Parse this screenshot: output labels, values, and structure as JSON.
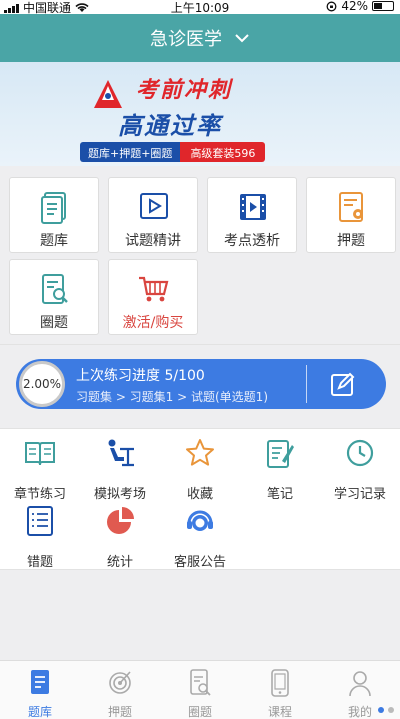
{
  "status_bar": {
    "carrier": "中国联通",
    "time": "上午10:09",
    "battery": "42%"
  },
  "header": {
    "title": "急诊医学"
  },
  "banner": {
    "headline": "考前冲刺",
    "subheadline": "高通过率",
    "bundle": "题库+押题+圈题",
    "package": "高级套装596"
  },
  "grid_items": [
    {
      "label": "题库",
      "icon": "question-bank-icon"
    },
    {
      "label": "试题精讲",
      "icon": "video-play-icon"
    },
    {
      "label": "考点透析",
      "icon": "film-icon"
    },
    {
      "label": "押题",
      "icon": "certificate-icon"
    },
    {
      "label": "圈题",
      "icon": "document-search-icon"
    },
    {
      "label": "激活/购买",
      "icon": "shopping-cart-icon"
    }
  ],
  "progress": {
    "percent": "2.00%",
    "title": "上次练习进度 5/100",
    "path": "习题集 > 习题集1 > 试题(单选题1)"
  },
  "features": [
    {
      "label": "章节练习",
      "icon": "open-book-icon"
    },
    {
      "label": "模拟考场",
      "icon": "exam-desk-icon"
    },
    {
      "label": "收藏",
      "icon": "star-icon"
    },
    {
      "label": "笔记",
      "icon": "notebook-icon"
    },
    {
      "label": "学习记录",
      "icon": "history-clock-icon"
    },
    {
      "label": "错题",
      "icon": "wrong-list-icon"
    },
    {
      "label": "统计",
      "icon": "pie-chart-icon"
    },
    {
      "label": "客服公告",
      "icon": "headset-icon"
    }
  ],
  "tabs": [
    {
      "label": "题库",
      "icon": "document-icon",
      "active": true
    },
    {
      "label": "押题",
      "icon": "target-icon",
      "active": false
    },
    {
      "label": "圈题",
      "icon": "circle-question-icon",
      "active": false
    },
    {
      "label": "课程",
      "icon": "tablet-icon",
      "active": false
    },
    {
      "label": "我的",
      "icon": "user-icon",
      "active": false
    }
  ],
  "colors": {
    "header": "#4aa5a6",
    "accent": "#3d7be2",
    "teal_icon": "#3f9e9d",
    "red": "#d9453f",
    "orange": "#e9953a"
  }
}
